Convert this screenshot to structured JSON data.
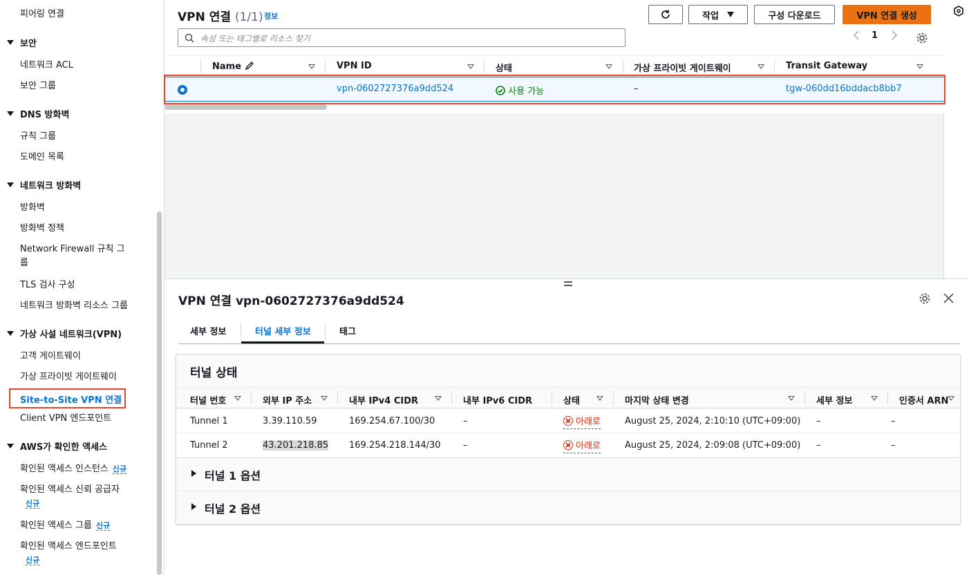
{
  "sidebar": {
    "top_item": "피어링 연결",
    "sections": [
      {
        "title": "보안",
        "items": [
          "네트워크 ACL",
          "보안 그룹"
        ]
      },
      {
        "title": "DNS 방화벽",
        "items": [
          "규칙 그룹",
          "도메인 목록"
        ]
      },
      {
        "title": "네트워크 방화벽",
        "items": [
          "방화벽",
          "방화벽 정책",
          "Network Firewall 규칙 그룹",
          "TLS 검사 구성",
          "네트워크 방화벽 리소스 그룹"
        ]
      },
      {
        "title": "가상 사설 네트워크(VPN)",
        "items": [
          "고객 게이트웨이",
          "가상 프라이빗 게이트웨이",
          "Site-to-Site VPN 연결",
          "Client VPN 엔드포인트"
        ]
      },
      {
        "title": "AWS가 확인한 액세스",
        "items": [
          "확인된 액세스 인스턴스",
          "확인된 액세스 신뢰 공급자",
          "확인된 액세스 그룹",
          "확인된 액세스 엔드포인트"
        ]
      }
    ],
    "network_firewall_rule_group_line1": "Network Firewall 규칙 그",
    "network_firewall_rule_group_line2": "룹",
    "new_badge": "신규"
  },
  "list": {
    "title": "VPN 연결",
    "count": "(1/1)",
    "info": "정보",
    "refresh_icon": "refresh-icon",
    "actions_label": "작업",
    "download_label": "구성 다운로드",
    "create_label": "VPN 연결 생성",
    "search_placeholder": "속성 또는 태그별로 리소스 찾기",
    "page": "1",
    "columns": [
      "Name",
      "VPN ID",
      "상태",
      "가상 프라이빗 게이트웨이",
      "Transit Gateway"
    ],
    "row": {
      "name": "",
      "vpn_id": "vpn-0602727376a9dd524",
      "status": "사용 가능",
      "vgw": "–",
      "tgw": "tgw-060dd16bddacb8bb7"
    }
  },
  "detail": {
    "title": "VPN 연결 vpn-0602727376a9dd524",
    "tabs": [
      "세부 정보",
      "터널 세부 정보",
      "태그"
    ],
    "active_tab": "터널 세부 정보",
    "card_title": "터널 상태",
    "columns": [
      "터널 번호",
      "외부 IP 주소",
      "내부 IPv4 CIDR",
      "내부 IPv6 CIDR",
      "상태",
      "마지막 상태 변경",
      "세부 정보",
      "인증서 ARN"
    ],
    "rows": [
      {
        "tunnel": "Tunnel 1",
        "outside_ip": "3.39.110.59",
        "inside_ipv4": "169.254.67.100/30",
        "inside_ipv6": "–",
        "status": "아래로",
        "last_change": "August 25, 2024, 2:10:10 (UTC+09:00)",
        "details": "–",
        "cert_arn": "–"
      },
      {
        "tunnel": "Tunnel 2",
        "outside_ip": "43.201.218.85",
        "inside_ipv4": "169.254.218.144/30",
        "inside_ipv6": "–",
        "status": "아래로",
        "last_change": "August 25, 2024, 2:09:08 (UTC+09:00)",
        "details": "–",
        "cert_arn": "–"
      }
    ],
    "expanders": [
      "터널 1 옵션",
      "터널 2 옵션"
    ]
  },
  "colors": {
    "accent": "#0972d3",
    "primary_button": "#ec7211",
    "highlight_box": "#e5452f",
    "ok": "#037f0c",
    "error": "#d13212"
  }
}
